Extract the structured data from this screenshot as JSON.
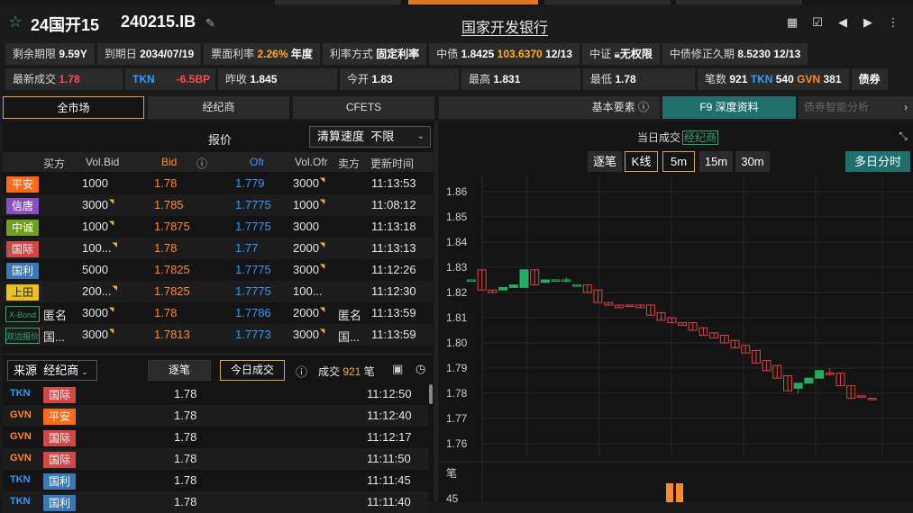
{
  "header": {
    "bond_name": "24国开15",
    "bond_code": "240215.IB",
    "issuer": "国家开发银行",
    "icons": [
      "calculator-icon",
      "checkbox-icon",
      "arrow-left-icon",
      "arrow-right-icon",
      "more-icon"
    ]
  },
  "info_row1": {
    "remaining_label": "剩余期限",
    "remaining": "9.59Y",
    "maturity_label": "到期日",
    "maturity": "2034/07/19",
    "coupon_label": "票面利率",
    "coupon": "2.26%",
    "coupon_unit": "年度",
    "rate_type_label": "利率方式",
    "rate_type": "固定利率",
    "cb_label": "中债",
    "cb_yield": "1.8425",
    "cb_price": "103.6370",
    "cb_date": "12/13",
    "cs_label": "中证",
    "cs_value": "无权限",
    "dur_label": "中债修正久期",
    "dur_value": "8.5230",
    "dur_date": "12/13"
  },
  "info_row2": {
    "last_label": "最新成交",
    "last": "1.78",
    "tkn": "TKN",
    "change": "-6.5BP",
    "prev_label": "昨收",
    "prev": "1.845",
    "open_label": "今开",
    "open": "1.83",
    "high_label": "最高",
    "high": "1.831",
    "low_label": "最低",
    "low": "1.78",
    "count_label": "笔数",
    "count": "921",
    "tkn2": "TKN",
    "tkn_count": "540",
    "gvn": "GVN",
    "gvn_count": "381",
    "tail": "债券"
  },
  "tabs": {
    "all_market": "全市场",
    "broker": "经纪商",
    "cfets": "CFETS",
    "basic": "基本要素",
    "f9": "F9 深度资料",
    "smart": "债券智能分析"
  },
  "quotes": {
    "title": "报价",
    "settle_label": "清算速度",
    "settle_value": "不限",
    "headers": {
      "buyer": "买方",
      "vol_bid": "Vol.Bid",
      "bid": "Bid",
      "ofr": "Ofr",
      "vol_ofr": "Vol.Ofr",
      "seller": "卖方",
      "update": "更新时间"
    },
    "rows": [
      {
        "broker": "平安",
        "color": "#ff6a1a",
        "vol_bid": "1000",
        "bid": "1.78",
        "ofr": "1.779",
        "vol_ofr": "3000",
        "time": "11:13:53",
        "bid_tri": false,
        "ofr_tri": true,
        "buyer": "",
        "seller": ""
      },
      {
        "broker": "信唐",
        "color": "#8a4fc0",
        "vol_bid": "3000",
        "bid": "1.785",
        "ofr": "1.7775",
        "vol_ofr": "1000",
        "time": "11:08:12",
        "bid_tri": true,
        "ofr_tri": true,
        "buyer": "",
        "seller": ""
      },
      {
        "broker": "中诚",
        "color": "#6fa020",
        "vol_bid": "1000",
        "bid": "1.7875",
        "ofr": "1.7775",
        "vol_ofr": "3000",
        "time": "11:13:18",
        "bid_tri": true,
        "ofr_tri": false,
        "buyer": "",
        "seller": ""
      },
      {
        "broker": "国际",
        "color": "#d04848",
        "vol_bid": "100...",
        "bid": "1.78",
        "ofr": "1.77",
        "vol_ofr": "2000",
        "time": "11:13:13",
        "bid_tri": true,
        "ofr_tri": true,
        "buyer": "",
        "seller": ""
      },
      {
        "broker": "国利",
        "color": "#3a78b8",
        "vol_bid": "5000",
        "bid": "1.7825",
        "ofr": "1.7775",
        "vol_ofr": "3000",
        "time": "11:12:26",
        "bid_tri": false,
        "ofr_tri": true,
        "buyer": "",
        "seller": ""
      },
      {
        "broker": "上田",
        "color": "#e8c020",
        "vol_bid": "200...",
        "bid": "1.7825",
        "ofr": "1.7775",
        "vol_ofr": "100...",
        "time": "11:12:30",
        "bid_tri": true,
        "ofr_tri": false,
        "buyer": "",
        "seller": ""
      },
      {
        "broker": "X-Bond",
        "color": "",
        "vol_bid": "3000",
        "bid": "1.78",
        "ofr": "1.7786",
        "vol_ofr": "2000",
        "time": "11:13:59",
        "bid_tri": true,
        "ofr_tri": true,
        "buyer": "匿名",
        "seller": "匿名"
      },
      {
        "broker": "双边报价",
        "color": "",
        "vol_bid": "3000",
        "bid": "1.7813",
        "ofr": "1.7773",
        "vol_ofr": "3000",
        "time": "11:13:59",
        "bid_tri": true,
        "ofr_tri": true,
        "buyer": "国...",
        "seller": "国..."
      }
    ]
  },
  "trades": {
    "source_label": "来源",
    "source_value": "经纪商",
    "tick_tab": "逐笔",
    "today_tab": "今日成交",
    "deal_label": "成交",
    "deal_count": "921",
    "deal_unit": "笔",
    "rows": [
      {
        "src": "TKN",
        "src_color": "#2f9bff",
        "broker": "国际",
        "broker_color": "#d04848",
        "price": "1.78",
        "time": "11:12:50"
      },
      {
        "src": "GVN",
        "src_color": "#ff8a2a",
        "broker": "平安",
        "broker_color": "#ff6a1a",
        "price": "1.78",
        "time": "11:12:40"
      },
      {
        "src": "GVN",
        "src_color": "#ff8a2a",
        "broker": "国际",
        "broker_color": "#d04848",
        "price": "1.78",
        "time": "11:12:17"
      },
      {
        "src": "GVN",
        "src_color": "#ff8a2a",
        "broker": "国际",
        "broker_color": "#d04848",
        "price": "1.78",
        "time": "11:11:50"
      },
      {
        "src": "TKN",
        "src_color": "#2f9bff",
        "broker": "国利",
        "broker_color": "#3a78b8",
        "price": "1.78",
        "time": "11:11:45"
      },
      {
        "src": "TKN",
        "src_color": "#2f9bff",
        "broker": "国利",
        "broker_color": "#3a78b8",
        "price": "1.78",
        "time": "11:11:40"
      }
    ]
  },
  "chart_panel": {
    "title": "当日成交",
    "title_link": "经纪商",
    "buttons": {
      "tick": "逐笔",
      "kline": "K线",
      "m5": "5m",
      "m15": "15m",
      "m30": "30m",
      "multi": "多日分时"
    }
  },
  "chart_data": {
    "type": "candlestick",
    "ylim": [
      1.755,
      1.865
    ],
    "yticks": [
      "1.86",
      "1.85",
      "1.84",
      "1.83",
      "1.82",
      "1.81",
      "1.80",
      "1.79",
      "1.78",
      "1.77",
      "1.76"
    ],
    "volume_label": "笔",
    "volume_tick": "45",
    "candles": [
      {
        "o": 1.825,
        "c": 1.825,
        "h": 1.825,
        "l": 1.825
      },
      {
        "o": 1.829,
        "c": 1.821,
        "h": 1.829,
        "l": 1.821
      },
      {
        "o": 1.821,
        "c": 1.82,
        "h": 1.821,
        "l": 1.82
      },
      {
        "o": 1.821,
        "c": 1.822,
        "h": 1.822,
        "l": 1.821
      },
      {
        "o": 1.822,
        "c": 1.823,
        "h": 1.823,
        "l": 1.822
      },
      {
        "o": 1.822,
        "c": 1.829,
        "h": 1.829,
        "l": 1.822
      },
      {
        "o": 1.829,
        "c": 1.823,
        "h": 1.829,
        "l": 1.823
      },
      {
        "o": 1.824,
        "c": 1.825,
        "h": 1.825,
        "l": 1.824
      },
      {
        "o": 1.825,
        "c": 1.825,
        "h": 1.825,
        "l": 1.825
      },
      {
        "o": 1.825,
        "c": 1.825,
        "h": 1.826,
        "l": 1.824
      },
      {
        "o": 1.823,
        "c": 1.823,
        "h": 1.823,
        "l": 1.823
      },
      {
        "o": 1.823,
        "c": 1.82,
        "h": 1.823,
        "l": 1.82
      },
      {
        "o": 1.821,
        "c": 1.816,
        "h": 1.821,
        "l": 1.816
      },
      {
        "o": 1.816,
        "c": 1.815,
        "h": 1.816,
        "l": 1.815
      },
      {
        "o": 1.815,
        "c": 1.814,
        "h": 1.815,
        "l": 1.814
      },
      {
        "o": 1.815,
        "c": 1.815,
        "h": 1.815,
        "l": 1.815
      },
      {
        "o": 1.815,
        "c": 1.814,
        "h": 1.815,
        "l": 1.814
      },
      {
        "o": 1.815,
        "c": 1.811,
        "h": 1.815,
        "l": 1.811
      },
      {
        "o": 1.812,
        "c": 1.809,
        "h": 1.812,
        "l": 1.809
      },
      {
        "o": 1.81,
        "c": 1.808,
        "h": 1.81,
        "l": 1.808
      },
      {
        "o": 1.808,
        "c": 1.807,
        "h": 1.808,
        "l": 1.807
      },
      {
        "o": 1.808,
        "c": 1.805,
        "h": 1.808,
        "l": 1.805
      },
      {
        "o": 1.806,
        "c": 1.803,
        "h": 1.806,
        "l": 1.803
      },
      {
        "o": 1.804,
        "c": 1.802,
        "h": 1.804,
        "l": 1.802
      },
      {
        "o": 1.803,
        "c": 1.8,
        "h": 1.803,
        "l": 1.8
      },
      {
        "o": 1.801,
        "c": 1.798,
        "h": 1.801,
        "l": 1.798
      },
      {
        "o": 1.799,
        "c": 1.796,
        "h": 1.799,
        "l": 1.796
      },
      {
        "o": 1.797,
        "c": 1.792,
        "h": 1.797,
        "l": 1.792
      },
      {
        "o": 1.793,
        "c": 1.789,
        "h": 1.793,
        "l": 1.789
      },
      {
        "o": 1.791,
        "c": 1.786,
        "h": 1.791,
        "l": 1.786
      },
      {
        "o": 1.787,
        "c": 1.781,
        "h": 1.787,
        "l": 1.781
      },
      {
        "o": 1.782,
        "c": 1.784,
        "h": 1.784,
        "l": 1.78
      },
      {
        "o": 1.784,
        "c": 1.786,
        "h": 1.786,
        "l": 1.784
      },
      {
        "o": 1.786,
        "c": 1.789,
        "h": 1.789,
        "l": 1.786
      },
      {
        "o": 1.788,
        "c": 1.788,
        "h": 1.79,
        "l": 1.787
      },
      {
        "o": 1.788,
        "c": 1.783,
        "h": 1.788,
        "l": 1.783
      },
      {
        "o": 1.783,
        "c": 1.778,
        "h": 1.783,
        "l": 1.778
      },
      {
        "o": 1.779,
        "c": 1.779,
        "h": 1.779,
        "l": 1.779
      },
      {
        "o": 1.778,
        "c": 1.778,
        "h": 1.778,
        "l": 1.778
      }
    ]
  }
}
